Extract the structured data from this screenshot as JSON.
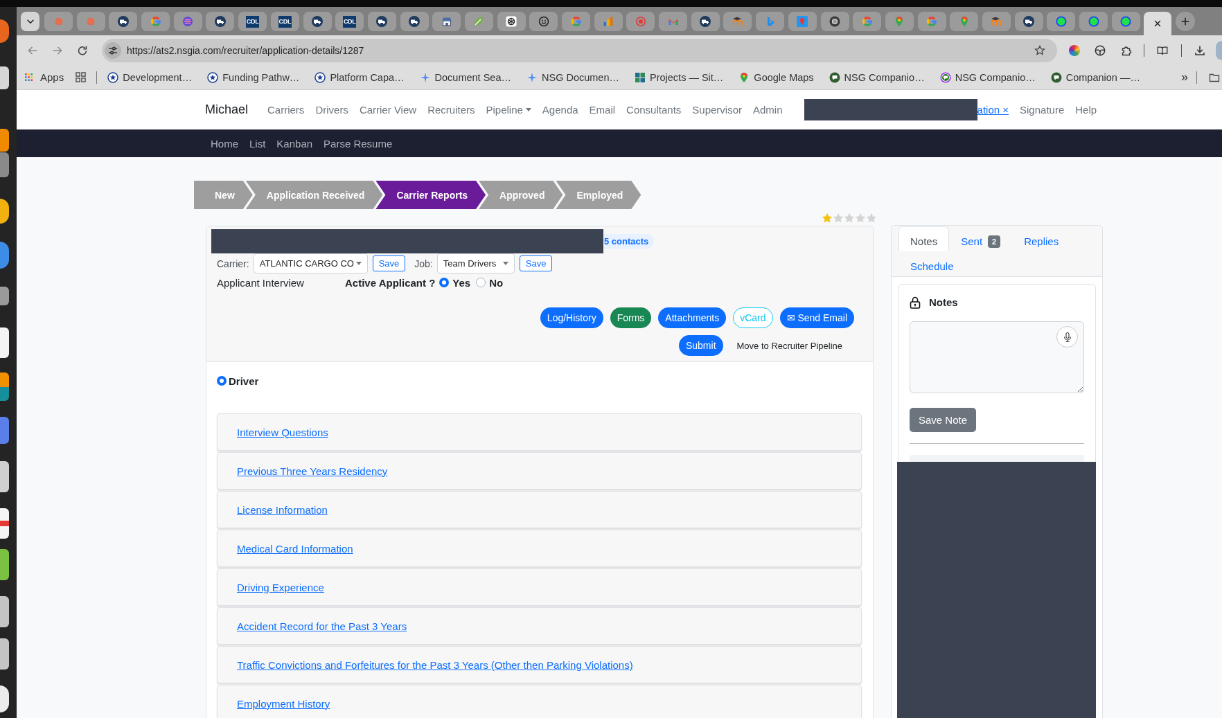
{
  "browser": {
    "tabs": [
      {
        "kind": "dot",
        "selected": false
      },
      {
        "kind": "dot",
        "selected": false
      },
      {
        "kind": "truck",
        "selected": false
      },
      {
        "kind": "ring4",
        "selected": false
      },
      {
        "kind": "stripes",
        "selected": false
      },
      {
        "kind": "truck",
        "selected": false
      },
      {
        "kind": "logo",
        "label": "CDL",
        "selected": false
      },
      {
        "kind": "logo",
        "label": "CDL",
        "selected": false
      },
      {
        "kind": "truck",
        "selected": false
      },
      {
        "kind": "logo",
        "label": "CDL",
        "selected": false
      },
      {
        "kind": "truck",
        "selected": false
      },
      {
        "kind": "truck",
        "selected": false
      },
      {
        "kind": "shop",
        "selected": false
      },
      {
        "kind": "leaf",
        "selected": false
      },
      {
        "kind": "knot",
        "selected": false
      },
      {
        "kind": "face",
        "selected": false
      },
      {
        "kind": "ring4",
        "selected": false
      },
      {
        "kind": "chart",
        "selected": false
      },
      {
        "kind": "target",
        "selected": false
      },
      {
        "kind": "mail",
        "selected": false
      },
      {
        "kind": "truck",
        "selected": false
      },
      {
        "kind": "cap",
        "selected": false
      },
      {
        "kind": "wave",
        "selected": false
      },
      {
        "kind": "pintile",
        "selected": false
      },
      {
        "kind": "aperture",
        "selected": false
      },
      {
        "kind": "ring4",
        "selected": false
      },
      {
        "kind": "mappin",
        "selected": false
      },
      {
        "kind": "ring4",
        "selected": false
      },
      {
        "kind": "mappin",
        "selected": false
      },
      {
        "kind": "cap",
        "selected": false
      },
      {
        "kind": "truck",
        "selected": false
      },
      {
        "kind": "dotring",
        "selected": false
      },
      {
        "kind": "dotring",
        "selected": false
      },
      {
        "kind": "dotring",
        "selected": false
      },
      {
        "kind": "blank",
        "selected": true
      }
    ],
    "url": "https://ats2.nsgia.com/recruiter/application-details/1287",
    "bookmarks": {
      "apps": "Apps",
      "items": [
        {
          "label": "Development…",
          "kind": "star"
        },
        {
          "label": "Funding Pathw…",
          "kind": "star"
        },
        {
          "label": "Platform Capa…",
          "kind": "star"
        },
        {
          "label": "Document Sea…",
          "kind": "sparkle"
        },
        {
          "label": "NSG Documen…",
          "kind": "sparkle"
        },
        {
          "label": "Projects — Sit…",
          "kind": "tiles"
        },
        {
          "label": "Google Maps",
          "kind": "mappin"
        },
        {
          "label": "NSG Companio…",
          "kind": "chat"
        },
        {
          "label": "NSG Companio…",
          "kind": "chatring"
        },
        {
          "label": "Companion —…",
          "kind": "chat"
        }
      ],
      "overflow": "»"
    }
  },
  "navbar": {
    "brand": "Michael",
    "links": [
      {
        "kind": "link",
        "label": "Carriers"
      },
      {
        "kind": "link",
        "label": "Drivers"
      },
      {
        "kind": "link",
        "label": "Carrier View"
      },
      {
        "kind": "link",
        "label": "Recruiters"
      },
      {
        "kind": "dropdown",
        "label": "Pipeline"
      },
      {
        "kind": "link",
        "label": "Agenda"
      },
      {
        "kind": "link",
        "label": "Email"
      },
      {
        "kind": "link",
        "label": "Consultants"
      },
      {
        "kind": "link",
        "label": "Supervisor"
      },
      {
        "kind": "link",
        "label": "Admin"
      },
      {
        "kind": "redacted"
      },
      {
        "kind": "current",
        "label": "ation ×"
      },
      {
        "kind": "link",
        "label": "Signature"
      },
      {
        "kind": "link",
        "label": "Help"
      }
    ]
  },
  "subnav": {
    "links": [
      "Home",
      "List",
      "Kanban",
      "Parse Resume"
    ]
  },
  "pipeline": [
    {
      "label": "New",
      "selected": false
    },
    {
      "label": "Application Received",
      "selected": false
    },
    {
      "label": "Carrier Reports",
      "selected": true
    },
    {
      "label": "Approved",
      "selected": false
    },
    {
      "label": "Employed",
      "selected": false
    }
  ],
  "rating": {
    "stars": 1
  },
  "applicant": {
    "name_redacted": true,
    "contacts": "5 contacts",
    "carrier": {
      "label": "Carrier:",
      "value": "ATLANTIC CARGO CO",
      "button": "Save"
    },
    "job": {
      "label": "Job:",
      "value": "Team Drivers",
      "button": "Save"
    },
    "interview": "Applicant Interview",
    "active": {
      "label": "Active Applicant ?",
      "options": [
        {
          "label": "Yes",
          "selected": true
        },
        {
          "label": "No",
          "selected": false
        }
      ]
    },
    "actions": [
      {
        "label": "Log/History",
        "kind": "primary"
      },
      {
        "label": "Forms",
        "kind": "success"
      },
      {
        "label": "Attachments",
        "kind": "primary"
      },
      {
        "label": "vCard",
        "kind": "outline"
      },
      {
        "label": "✉ Send Email",
        "kind": "primary"
      }
    ],
    "submit": "Submit",
    "move": "Move to Recruiter Pipeline"
  },
  "form": {
    "role": {
      "label": "Driver",
      "selected": true
    },
    "sections": [
      "Interview Questions",
      "Previous Three Years Residency",
      "License Information",
      "Medical Card Information",
      "Driving Experience",
      "Accident Record for the Past 3 Years",
      "Traffic Convictions and Forfeitures for the Past 3 Years (Other then Parking Violations)",
      "Employment History"
    ]
  },
  "notes_panel": {
    "tabs": [
      {
        "label": "Notes",
        "selected": true
      },
      {
        "label": "Sent",
        "badge": "2",
        "selected": false
      },
      {
        "label": "Replies",
        "selected": false
      },
      {
        "label": "Schedule",
        "selected": false
      }
    ],
    "title": "Notes",
    "save": "Save Note",
    "history_redacted": true
  }
}
